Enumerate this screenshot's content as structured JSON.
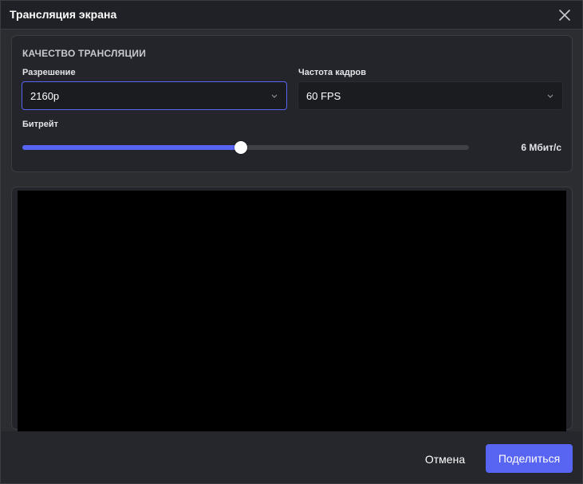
{
  "window": {
    "title": "Трансляция экрана"
  },
  "quality": {
    "section_title": "КАЧЕСТВО ТРАНСЛЯЦИИ",
    "resolution": {
      "label": "Разрешение",
      "value": "2160p"
    },
    "framerate": {
      "label": "Частота кадров",
      "value": "60 FPS"
    },
    "bitrate": {
      "label": "Битрейт",
      "value_text": "6 Мбит/с",
      "slider_fraction": 0.49
    }
  },
  "footer": {
    "cancel_label": "Отмена",
    "share_label": "Поделиться"
  },
  "colors": {
    "accent": "#5865f2",
    "background": "#2b2d31",
    "preview": "#000000"
  },
  "icons": {
    "close": "close-icon",
    "dropdown": "chevron-down-icon"
  }
}
